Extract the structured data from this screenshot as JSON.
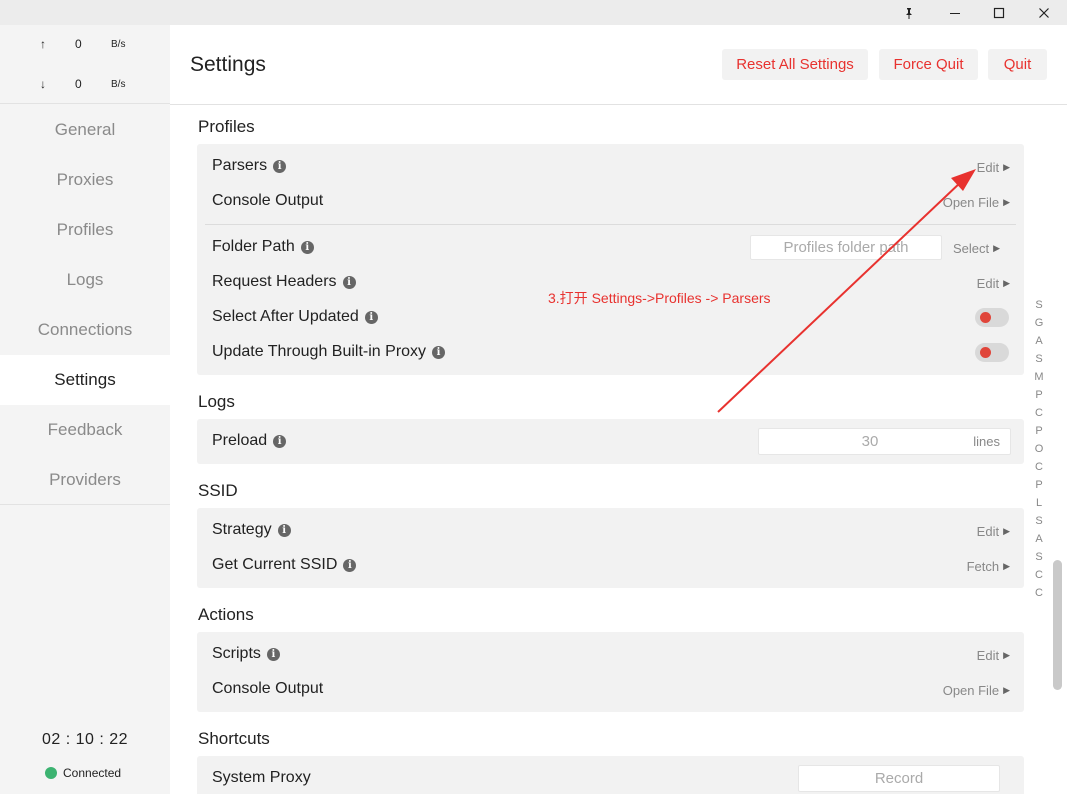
{
  "titlebar": {
    "pin_icon": "pin-icon",
    "min_icon": "minimize-icon",
    "max_icon": "maximize-icon",
    "close_icon": "close-icon"
  },
  "traffic": {
    "up_arrow": "↑",
    "up_value": "0",
    "up_unit": "B/s",
    "down_arrow": "↓",
    "down_value": "0",
    "down_unit": "B/s"
  },
  "nav": {
    "items": [
      "General",
      "Proxies",
      "Profiles",
      "Logs",
      "Connections",
      "Settings",
      "Feedback",
      "Providers"
    ],
    "active": "Settings"
  },
  "footer": {
    "clock": "02 : 10 : 22",
    "status": "Connected",
    "status_color": "#3cb371"
  },
  "header": {
    "title": "Settings",
    "reset_label": "Reset All Settings",
    "force_quit_label": "Force Quit",
    "quit_label": "Quit",
    "button_text_color": "#e8322f"
  },
  "sections": {
    "profiles": {
      "title": "Profiles",
      "parsers": {
        "label": "Parsers",
        "action": "Edit"
      },
      "console_output": {
        "label": "Console Output",
        "action": "Open File"
      },
      "folder_path": {
        "label": "Folder Path",
        "placeholder": "Profiles folder path",
        "action": "Select"
      },
      "request_headers": {
        "label": "Request Headers",
        "action": "Edit"
      },
      "select_after_updated": {
        "label": "Select After Updated",
        "enabled": false
      },
      "update_through_proxy": {
        "label": "Update Through Built-in Proxy",
        "enabled": false
      }
    },
    "logs": {
      "title": "Logs",
      "preload": {
        "label": "Preload",
        "value": "30",
        "unit": "lines"
      }
    },
    "ssid": {
      "title": "SSID",
      "strategy": {
        "label": "Strategy",
        "action": "Edit"
      },
      "current_ssid": {
        "label": "Get Current SSID",
        "action": "Fetch"
      }
    },
    "actions": {
      "title": "Actions",
      "scripts": {
        "label": "Scripts",
        "action": "Edit"
      },
      "console_output": {
        "label": "Console Output",
        "action": "Open File"
      }
    },
    "shortcuts": {
      "title": "Shortcuts",
      "system_proxy": {
        "label": "System Proxy",
        "placeholder": "Record"
      }
    }
  },
  "alpha_index": [
    "S",
    "G",
    "A",
    "S",
    "M",
    "P",
    "C",
    "P",
    "O",
    "C",
    "P",
    "L",
    "S",
    "A",
    "S",
    "C",
    "C"
  ],
  "annotation": {
    "text": "3.打开 Settings->Profiles -> Parsers",
    "color": "#e8322f"
  }
}
